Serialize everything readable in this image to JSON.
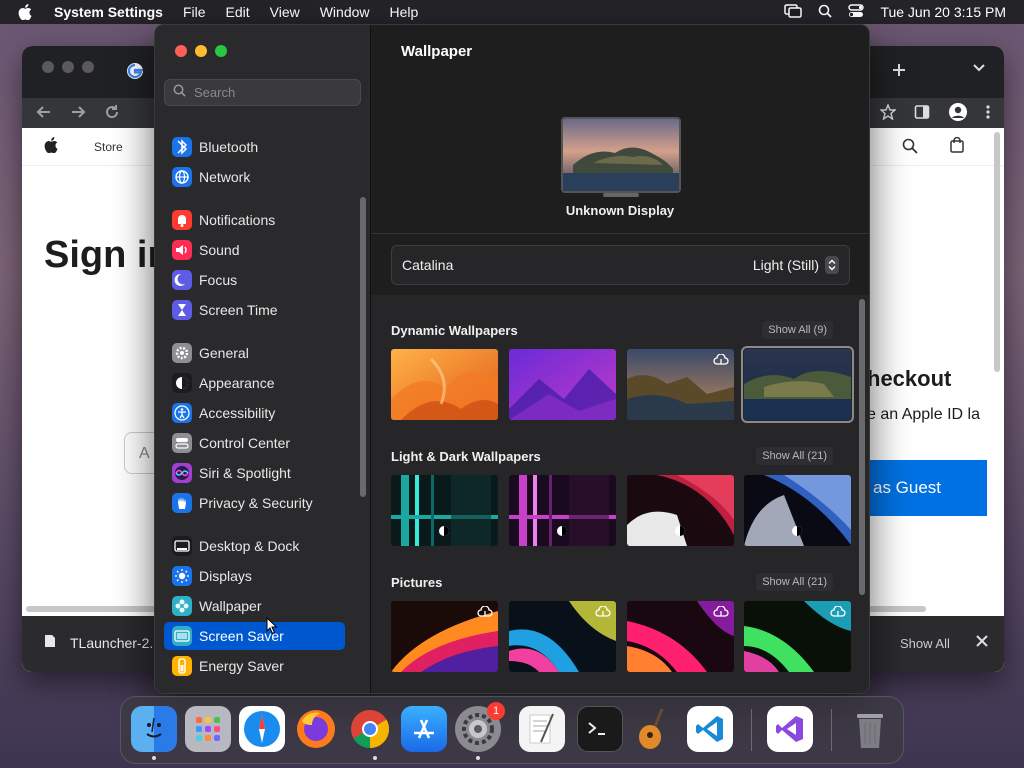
{
  "menubar": {
    "app": "System Settings",
    "items": [
      "File",
      "Edit",
      "View",
      "Window",
      "Help"
    ],
    "clock": "Tue Jun 20  3:15 PM"
  },
  "browser": {
    "nav": {
      "store": "Store"
    },
    "heading": "Sign in",
    "field_text": "A",
    "checkout": "heckout",
    "apple_id_text": "e an Apple ID la",
    "guest_button": "as Guest",
    "download_file": "TLauncher-2.",
    "show_all": "Show All"
  },
  "settings": {
    "search_placeholder": "Search",
    "sidebar": [
      {
        "label": "Bluetooth",
        "icon": "bluetooth-icon",
        "color": "#1a73e8"
      },
      {
        "label": "Network",
        "icon": "globe-icon",
        "color": "#1a73e8"
      },
      {
        "label": "Notifications",
        "icon": "bell-icon",
        "color": "#ff3b30"
      },
      {
        "label": "Sound",
        "icon": "speaker-icon",
        "color": "#ff2d55"
      },
      {
        "label": "Focus",
        "icon": "moon-icon",
        "color": "#5e5ce6"
      },
      {
        "label": "Screen Time",
        "icon": "hourglass-icon",
        "color": "#5e5ce6"
      },
      {
        "label": "General",
        "icon": "gear-icon",
        "color": "#8e8e93"
      },
      {
        "label": "Appearance",
        "icon": "appearance-icon",
        "color": "#1c1c1e"
      },
      {
        "label": "Accessibility",
        "icon": "accessibility-icon",
        "color": "#1a73e8"
      },
      {
        "label": "Control Center",
        "icon": "control-center-icon",
        "color": "#8e8e93"
      },
      {
        "label": "Siri & Spotlight",
        "icon": "siri-icon",
        "color": "#a23fd3"
      },
      {
        "label": "Privacy & Security",
        "icon": "hand-icon",
        "color": "#1a73e8"
      },
      {
        "label": "Desktop & Dock",
        "icon": "dock-icon",
        "color": "#1c1c1e"
      },
      {
        "label": "Displays",
        "icon": "sun-icon",
        "color": "#1a73e8"
      },
      {
        "label": "Wallpaper",
        "icon": "flower-icon",
        "color": "#30b0c7"
      },
      {
        "label": "Screen Saver",
        "icon": "screensaver-icon",
        "color": "#30b0c7"
      },
      {
        "label": "Energy Saver",
        "icon": "battery-icon",
        "color": "#ffb300"
      }
    ],
    "page_title": "Wallpaper",
    "display_name": "Unknown Display",
    "current_wallpaper": "Catalina",
    "style_value": "Light (Still)",
    "sections": [
      {
        "title": "Dynamic Wallpapers",
        "show_all": "Show All (9)"
      },
      {
        "title": "Light & Dark Wallpapers",
        "show_all": "Show All (21)"
      },
      {
        "title": "Pictures",
        "show_all": "Show All (21)"
      }
    ]
  },
  "dock": {
    "apps": [
      "finder",
      "launchpad",
      "safari",
      "firefox",
      "chrome",
      "app-store",
      "system-settings",
      "textedit",
      "terminal",
      "garageband",
      "vscode",
      "visual-studio",
      "trash"
    ],
    "settings_badge": "1"
  }
}
